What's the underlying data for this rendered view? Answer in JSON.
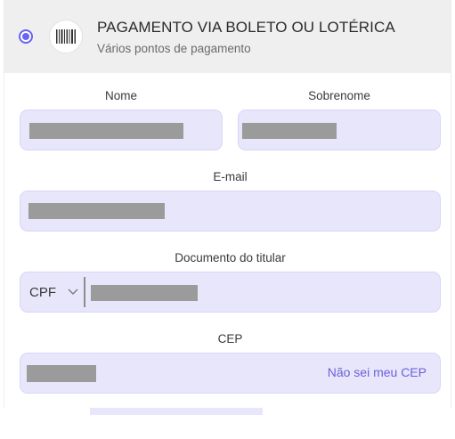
{
  "payment_option": {
    "title": "PAGAMENTO VIA BOLETO OU LOTÉRICA",
    "subtitle": "Vários pontos de pagamento",
    "selected": true,
    "icon": "barcode-icon"
  },
  "form": {
    "nome_label": "Nome",
    "sobrenome_label": "Sobrenome",
    "email_label": "E-mail",
    "documento_label": "Documento do titular",
    "documento_type": "CPF",
    "cep_label": "CEP",
    "cep_link": "Não sei meu CEP"
  },
  "colors": {
    "accent": "#6a62f2",
    "field_bg": "#e8e6fb",
    "link": "#6a62d8",
    "header_bg": "#efefef"
  }
}
